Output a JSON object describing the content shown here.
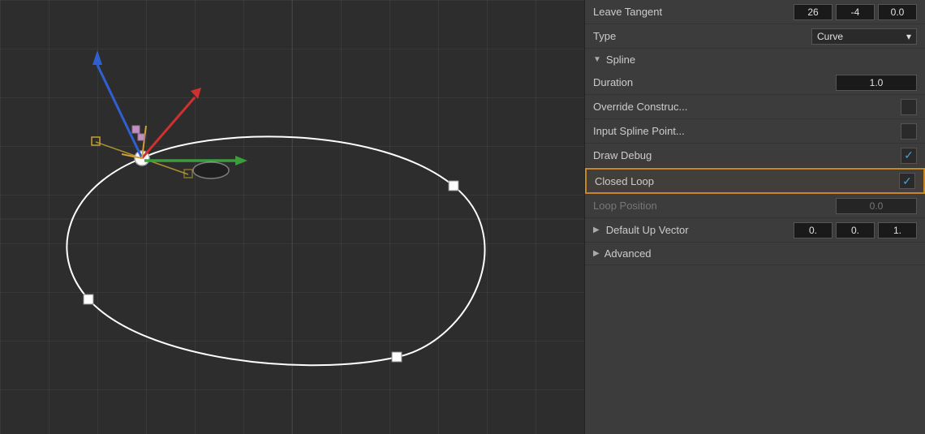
{
  "panel": {
    "leave_tangent": {
      "label": "Leave Tangent",
      "x": "26",
      "y": "-4",
      "z": "0.0"
    },
    "type": {
      "label": "Type",
      "value": "Curve",
      "dropdown_arrow": "▾"
    },
    "spline_section": {
      "label": "Spline",
      "collapsed": false
    },
    "duration": {
      "label": "Duration",
      "value": "1.0"
    },
    "override_construct": {
      "label": "Override Construc...",
      "checked": false
    },
    "input_spline_point": {
      "label": "Input Spline Point...",
      "checked": false
    },
    "draw_debug": {
      "label": "Draw Debug",
      "checked": true
    },
    "closed_loop": {
      "label": "Closed Loop",
      "checked": true
    },
    "loop_position": {
      "label": "Loop Position",
      "value": "0.0"
    },
    "default_up_vector": {
      "label": "Default Up Vector",
      "x": "0.",
      "y": "0.",
      "z": "1."
    },
    "advanced": {
      "label": "Advanced"
    }
  }
}
